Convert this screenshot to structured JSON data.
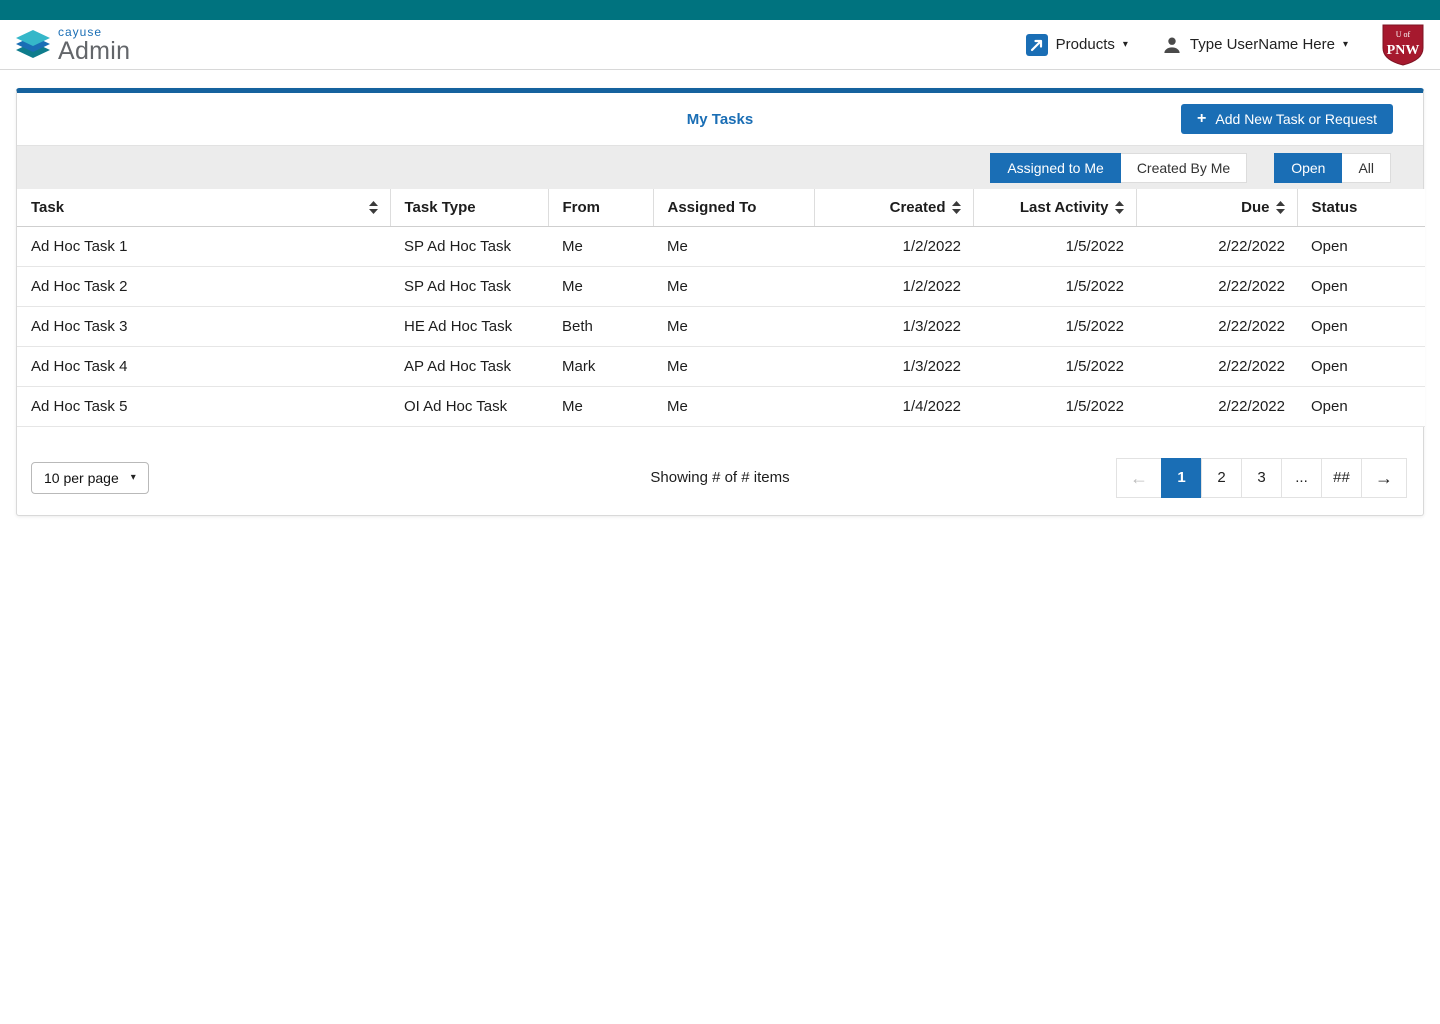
{
  "colors": {
    "teal": "#00737f",
    "accent-blue": "#1a6eb5",
    "card-top": "#15629e",
    "org-red": "#a6192e"
  },
  "header": {
    "brand": "cayuse",
    "product": "Admin",
    "products_label": "Products",
    "user_label": "Type UserName Here",
    "org": {
      "line1": "U of",
      "line2": "PNW"
    }
  },
  "panel": {
    "title": "My Tasks",
    "add_button_label": "Add New Task or Request",
    "filters": {
      "assigned_to_me": "Assigned to Me",
      "created_by_me": "Created By Me",
      "open": "Open",
      "all": "All"
    },
    "table": {
      "columns": [
        "Task",
        "Task Type",
        "From",
        "Assigned To",
        "Created",
        "Last Activity",
        "Due",
        "Status"
      ],
      "rows": [
        {
          "task": "Ad Hoc Task 1",
          "type": "SP Ad Hoc Task",
          "from": "Me",
          "assigned": "Me",
          "created": "1/2/2022",
          "last_activity": "1/5/2022",
          "due": "2/22/2022",
          "status": "Open"
        },
        {
          "task": "Ad Hoc Task 2",
          "type": "SP Ad Hoc Task",
          "from": "Me",
          "assigned": "Me",
          "created": "1/2/2022",
          "last_activity": "1/5/2022",
          "due": "2/22/2022",
          "status": "Open"
        },
        {
          "task": "Ad Hoc Task 3",
          "type": "HE Ad Hoc Task",
          "from": "Beth",
          "assigned": "Me",
          "created": "1/3/2022",
          "last_activity": "1/5/2022",
          "due": "2/22/2022",
          "status": "Open"
        },
        {
          "task": "Ad Hoc Task 4",
          "type": "AP Ad Hoc Task",
          "from": "Mark",
          "assigned": "Me",
          "created": "1/3/2022",
          "last_activity": "1/5/2022",
          "due": "2/22/2022",
          "status": "Open"
        },
        {
          "task": "Ad Hoc Task 5",
          "type": "OI Ad Hoc Task",
          "from": "Me",
          "assigned": "Me",
          "created": "1/4/2022",
          "last_activity": "1/5/2022",
          "due": "2/22/2022",
          "status": "Open"
        }
      ]
    },
    "footer": {
      "per_page_label": "10 per page",
      "showing_text": "Showing # of # items",
      "pages": [
        "1",
        "2",
        "3",
        "...",
        "##"
      ]
    }
  }
}
